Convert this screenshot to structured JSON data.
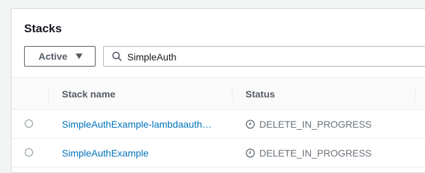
{
  "panel": {
    "title": "Stacks"
  },
  "filter": {
    "selected": "Active"
  },
  "search": {
    "value": "SimpleAuth"
  },
  "table": {
    "columns": [
      "Stack name",
      "Status"
    ],
    "rows": [
      {
        "stack_name": "SimpleAuthExample-lambdaauth…",
        "status": "DELETE_IN_PROGRESS"
      },
      {
        "stack_name": "SimpleAuthExample",
        "status": "DELETE_IN_PROGRESS"
      }
    ]
  },
  "colors": {
    "link": "#0073bb",
    "status_text": "#687078"
  }
}
